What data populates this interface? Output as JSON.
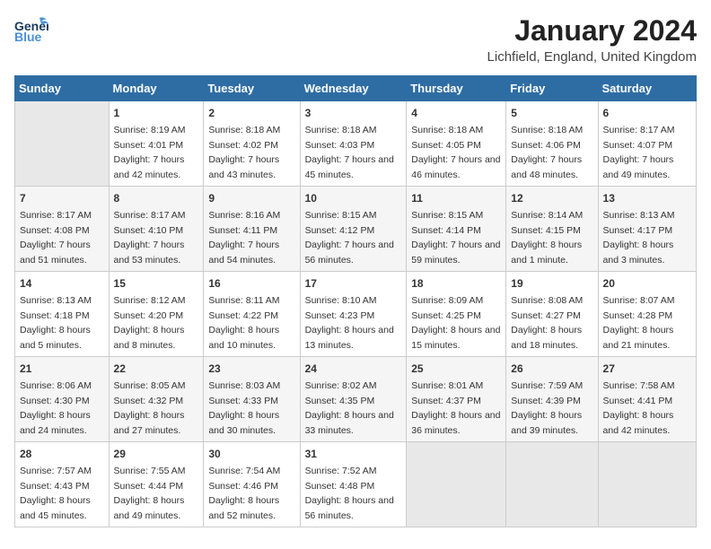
{
  "header": {
    "logo_line1": "General",
    "logo_line2": "Blue",
    "month_title": "January 2024",
    "location": "Lichfield, England, United Kingdom"
  },
  "weekdays": [
    "Sunday",
    "Monday",
    "Tuesday",
    "Wednesday",
    "Thursday",
    "Friday",
    "Saturday"
  ],
  "weeks": [
    [
      {
        "day": "",
        "sunrise": "",
        "sunset": "",
        "daylight": ""
      },
      {
        "day": "1",
        "sunrise": "Sunrise: 8:19 AM",
        "sunset": "Sunset: 4:01 PM",
        "daylight": "Daylight: 7 hours and 42 minutes."
      },
      {
        "day": "2",
        "sunrise": "Sunrise: 8:18 AM",
        "sunset": "Sunset: 4:02 PM",
        "daylight": "Daylight: 7 hours and 43 minutes."
      },
      {
        "day": "3",
        "sunrise": "Sunrise: 8:18 AM",
        "sunset": "Sunset: 4:03 PM",
        "daylight": "Daylight: 7 hours and 45 minutes."
      },
      {
        "day": "4",
        "sunrise": "Sunrise: 8:18 AM",
        "sunset": "Sunset: 4:05 PM",
        "daylight": "Daylight: 7 hours and 46 minutes."
      },
      {
        "day": "5",
        "sunrise": "Sunrise: 8:18 AM",
        "sunset": "Sunset: 4:06 PM",
        "daylight": "Daylight: 7 hours and 48 minutes."
      },
      {
        "day": "6",
        "sunrise": "Sunrise: 8:17 AM",
        "sunset": "Sunset: 4:07 PM",
        "daylight": "Daylight: 7 hours and 49 minutes."
      }
    ],
    [
      {
        "day": "7",
        "sunrise": "Sunrise: 8:17 AM",
        "sunset": "Sunset: 4:08 PM",
        "daylight": "Daylight: 7 hours and 51 minutes."
      },
      {
        "day": "8",
        "sunrise": "Sunrise: 8:17 AM",
        "sunset": "Sunset: 4:10 PM",
        "daylight": "Daylight: 7 hours and 53 minutes."
      },
      {
        "day": "9",
        "sunrise": "Sunrise: 8:16 AM",
        "sunset": "Sunset: 4:11 PM",
        "daylight": "Daylight: 7 hours and 54 minutes."
      },
      {
        "day": "10",
        "sunrise": "Sunrise: 8:15 AM",
        "sunset": "Sunset: 4:12 PM",
        "daylight": "Daylight: 7 hours and 56 minutes."
      },
      {
        "day": "11",
        "sunrise": "Sunrise: 8:15 AM",
        "sunset": "Sunset: 4:14 PM",
        "daylight": "Daylight: 7 hours and 59 minutes."
      },
      {
        "day": "12",
        "sunrise": "Sunrise: 8:14 AM",
        "sunset": "Sunset: 4:15 PM",
        "daylight": "Daylight: 8 hours and 1 minute."
      },
      {
        "day": "13",
        "sunrise": "Sunrise: 8:13 AM",
        "sunset": "Sunset: 4:17 PM",
        "daylight": "Daylight: 8 hours and 3 minutes."
      }
    ],
    [
      {
        "day": "14",
        "sunrise": "Sunrise: 8:13 AM",
        "sunset": "Sunset: 4:18 PM",
        "daylight": "Daylight: 8 hours and 5 minutes."
      },
      {
        "day": "15",
        "sunrise": "Sunrise: 8:12 AM",
        "sunset": "Sunset: 4:20 PM",
        "daylight": "Daylight: 8 hours and 8 minutes."
      },
      {
        "day": "16",
        "sunrise": "Sunrise: 8:11 AM",
        "sunset": "Sunset: 4:22 PM",
        "daylight": "Daylight: 8 hours and 10 minutes."
      },
      {
        "day": "17",
        "sunrise": "Sunrise: 8:10 AM",
        "sunset": "Sunset: 4:23 PM",
        "daylight": "Daylight: 8 hours and 13 minutes."
      },
      {
        "day": "18",
        "sunrise": "Sunrise: 8:09 AM",
        "sunset": "Sunset: 4:25 PM",
        "daylight": "Daylight: 8 hours and 15 minutes."
      },
      {
        "day": "19",
        "sunrise": "Sunrise: 8:08 AM",
        "sunset": "Sunset: 4:27 PM",
        "daylight": "Daylight: 8 hours and 18 minutes."
      },
      {
        "day": "20",
        "sunrise": "Sunrise: 8:07 AM",
        "sunset": "Sunset: 4:28 PM",
        "daylight": "Daylight: 8 hours and 21 minutes."
      }
    ],
    [
      {
        "day": "21",
        "sunrise": "Sunrise: 8:06 AM",
        "sunset": "Sunset: 4:30 PM",
        "daylight": "Daylight: 8 hours and 24 minutes."
      },
      {
        "day": "22",
        "sunrise": "Sunrise: 8:05 AM",
        "sunset": "Sunset: 4:32 PM",
        "daylight": "Daylight: 8 hours and 27 minutes."
      },
      {
        "day": "23",
        "sunrise": "Sunrise: 8:03 AM",
        "sunset": "Sunset: 4:33 PM",
        "daylight": "Daylight: 8 hours and 30 minutes."
      },
      {
        "day": "24",
        "sunrise": "Sunrise: 8:02 AM",
        "sunset": "Sunset: 4:35 PM",
        "daylight": "Daylight: 8 hours and 33 minutes."
      },
      {
        "day": "25",
        "sunrise": "Sunrise: 8:01 AM",
        "sunset": "Sunset: 4:37 PM",
        "daylight": "Daylight: 8 hours and 36 minutes."
      },
      {
        "day": "26",
        "sunrise": "Sunrise: 7:59 AM",
        "sunset": "Sunset: 4:39 PM",
        "daylight": "Daylight: 8 hours and 39 minutes."
      },
      {
        "day": "27",
        "sunrise": "Sunrise: 7:58 AM",
        "sunset": "Sunset: 4:41 PM",
        "daylight": "Daylight: 8 hours and 42 minutes."
      }
    ],
    [
      {
        "day": "28",
        "sunrise": "Sunrise: 7:57 AM",
        "sunset": "Sunset: 4:43 PM",
        "daylight": "Daylight: 8 hours and 45 minutes."
      },
      {
        "day": "29",
        "sunrise": "Sunrise: 7:55 AM",
        "sunset": "Sunset: 4:44 PM",
        "daylight": "Daylight: 8 hours and 49 minutes."
      },
      {
        "day": "30",
        "sunrise": "Sunrise: 7:54 AM",
        "sunset": "Sunset: 4:46 PM",
        "daylight": "Daylight: 8 hours and 52 minutes."
      },
      {
        "day": "31",
        "sunrise": "Sunrise: 7:52 AM",
        "sunset": "Sunset: 4:48 PM",
        "daylight": "Daylight: 8 hours and 56 minutes."
      },
      {
        "day": "",
        "sunrise": "",
        "sunset": "",
        "daylight": ""
      },
      {
        "day": "",
        "sunrise": "",
        "sunset": "",
        "daylight": ""
      },
      {
        "day": "",
        "sunrise": "",
        "sunset": "",
        "daylight": ""
      }
    ]
  ]
}
